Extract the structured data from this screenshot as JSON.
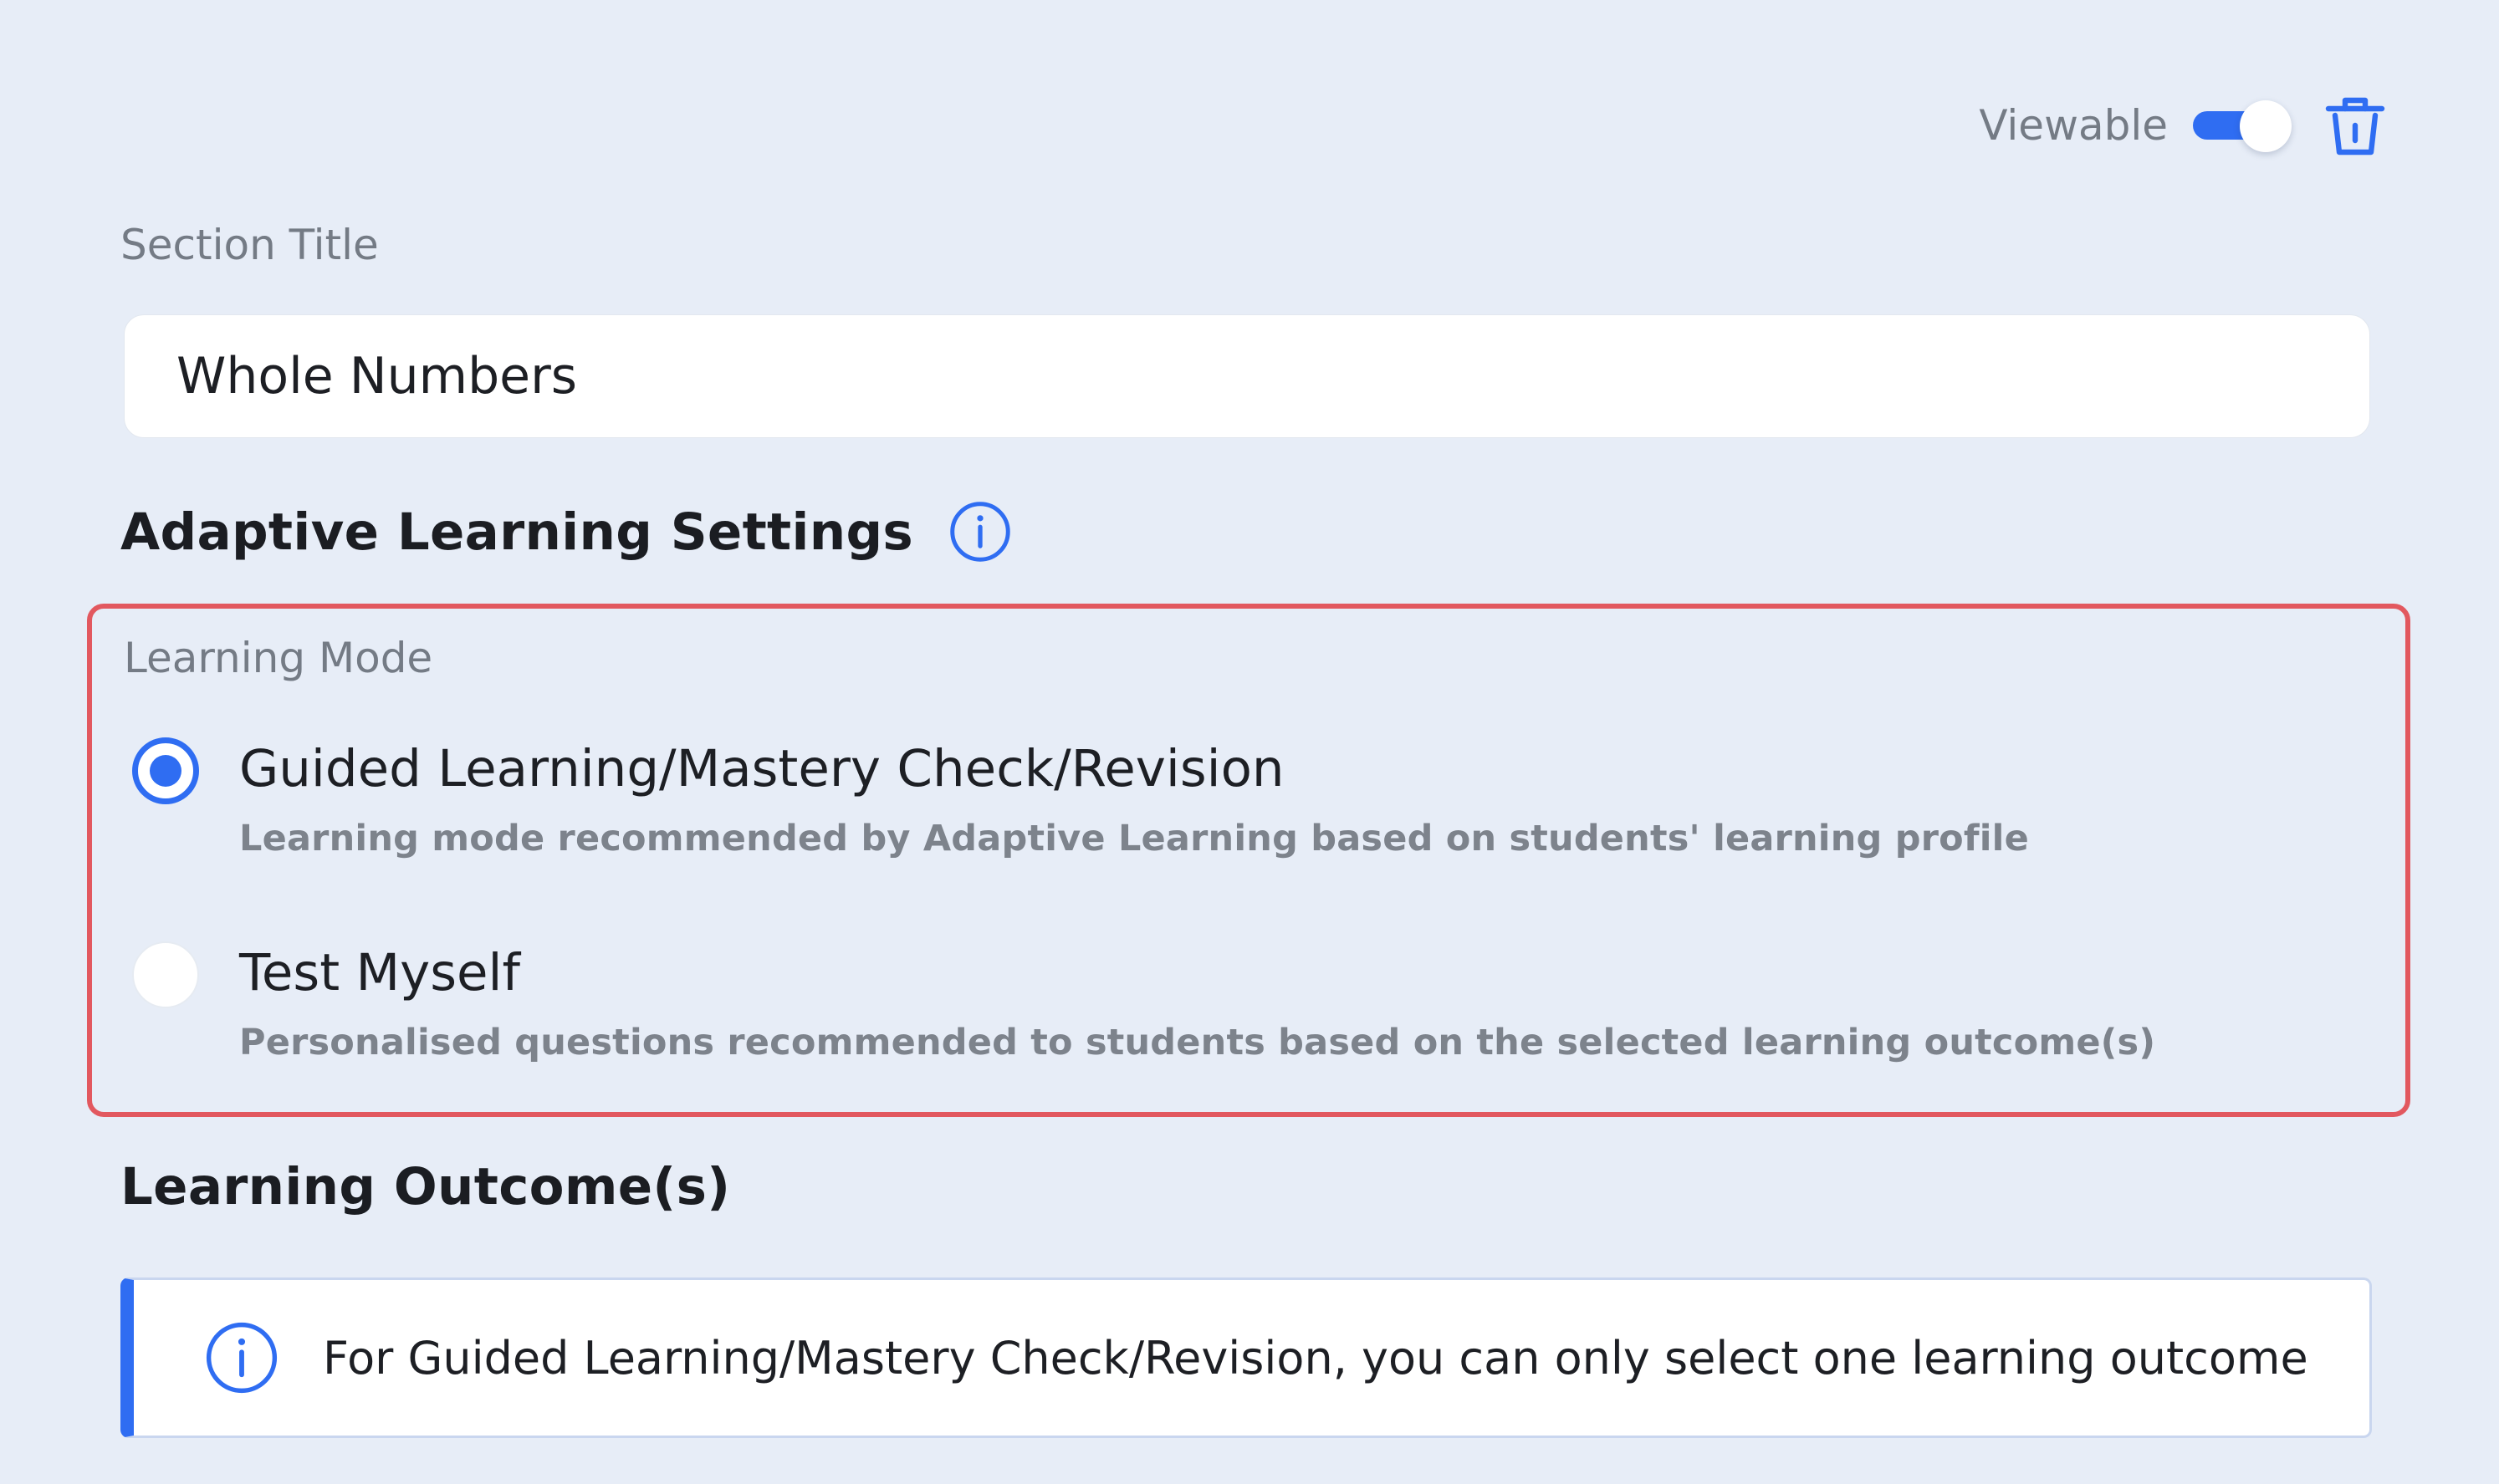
{
  "header": {
    "viewable_label": "Viewable",
    "viewable_on": true
  },
  "section_title": {
    "label": "Section Title",
    "value": "Whole Numbers"
  },
  "adaptive_settings": {
    "heading": "Adaptive Learning Settings",
    "learning_mode": {
      "label": "Learning Mode",
      "selected": "guided",
      "options": [
        {
          "id": "guided",
          "title": "Guided Learning/Mastery Check/Revision",
          "description": "Learning mode recommended by Adaptive Learning based on students' learning profile"
        },
        {
          "id": "test",
          "title": "Test Myself",
          "description": "Personalised questions recommended to students based on the selected learning outcome(s)"
        }
      ]
    }
  },
  "learning_outcomes": {
    "heading": "Learning Outcome(s)",
    "info_banner": "For Guided Learning/Mastery Check/Revision, you can only select one learning outcome"
  },
  "colors": {
    "background": "#e7edf7",
    "accent": "#2f6df2",
    "highlight_border": "#e2585f",
    "muted_text": "#747b85"
  },
  "icons": {
    "delete": "trash-icon",
    "info": "info-icon"
  }
}
